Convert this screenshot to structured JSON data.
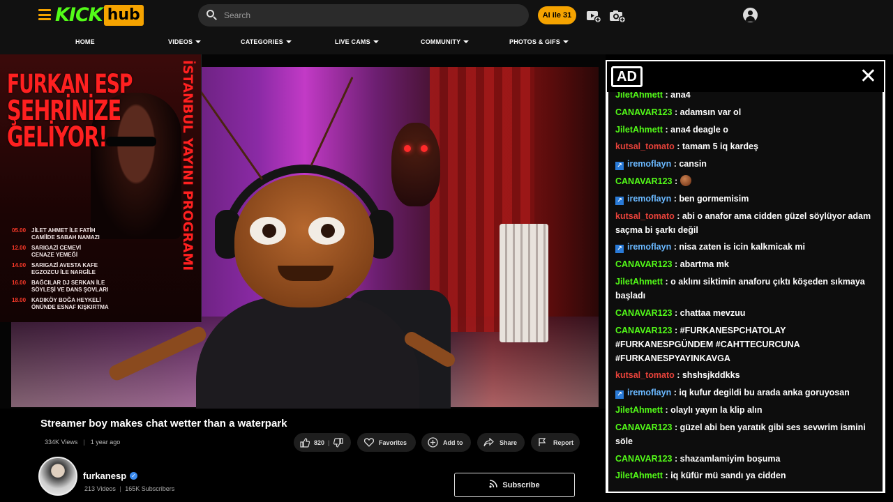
{
  "header": {
    "logo_kick": "KICK",
    "logo_hub": "hub",
    "search_placeholder": "Search",
    "ai_button": "AI ile 31"
  },
  "nav": [
    {
      "label": "HOME"
    },
    {
      "label": "VIDEOS"
    },
    {
      "label": "CATEGORIES"
    },
    {
      "label": "LIVE CAMS"
    },
    {
      "label": "COMMUNITY"
    },
    {
      "label": "PHOTOS & GIFS"
    }
  ],
  "poster": {
    "title_line1": "FURKAN ESP",
    "title_line2": "ŞEHRİNİZE",
    "title_line3": "GELİYOR!",
    "vertical_text": "İSTANBUL YAYINI PROGRAMI",
    "schedule": [
      {
        "time": "05.00",
        "text": "JİLET AHMET İLE FATİH\nCAMİİDE SABAH NAMAZI"
      },
      {
        "time": "12.00",
        "text": "SARIGAZİ CEMEVİ\nCENAZE YEMEĞİ"
      },
      {
        "time": "14.00",
        "text": "SARIGAZİ AVESTA KAFE\nEGZOZCU İLE NARGİLE"
      },
      {
        "time": "16.00",
        "text": "BAĞCILAR DJ SERKAN İLE\nSÖYLEŞİ VE DANS ŞOVLARI"
      },
      {
        "time": "18.00",
        "text": "KADIKÖY BOĞA HEYKELİ\nÖNÜNDE ESNAF KIŞKIRTMA"
      }
    ]
  },
  "video": {
    "title": "Streamer boy makes chat wetter than a waterpark",
    "views": "334K Views",
    "age": "1 year ago",
    "sep": "|",
    "likes": "820",
    "favorites_label": "Favorites",
    "add_label": "Add to",
    "share_label": "Share",
    "report_label": "Report"
  },
  "channel": {
    "name": "furkanesp",
    "videos": "213 Videos",
    "subscribers": "165K Subscribers",
    "sep": "|",
    "subscribe_label": "Subscribe"
  },
  "ad": {
    "label": "AD",
    "close": "✕"
  },
  "chat": [
    {
      "user": "JiletAhmett",
      "color": "green",
      "text": " : ana4"
    },
    {
      "user": "CANAVAR123",
      "color": "green",
      "text": " : adamsın var ol"
    },
    {
      "user": "JiletAhmett",
      "color": "green",
      "text": " : ana4 deagle o"
    },
    {
      "user": "kutsal_tomato",
      "color": "red",
      "text": " : tamam 5 iq kardeş"
    },
    {
      "user": "iremoflayn",
      "color": "blue",
      "text": " : cansin"
    },
    {
      "user": "CANAVAR123",
      "color": "green",
      "text": " :"
    },
    {
      "user": "iremoflayn",
      "color": "blue",
      "text": " : ben gormemisim"
    },
    {
      "user": "kutsal_tomato",
      "color": "red",
      "text": " : abi o anafor ama cidden güzel söylüyor adam saçma bi şarkı değil"
    },
    {
      "user": "iremoflayn",
      "color": "blue",
      "text": " : nisa zaten is icin kalkmicak mi"
    },
    {
      "user": "CANAVAR123",
      "color": "green",
      "text": " : abartma mk"
    },
    {
      "user": "JiletAhmett",
      "color": "green",
      "text": " : o aklını siktimin anaforu çıktı köşeden sıkmaya başladı"
    },
    {
      "user": "CANAVAR123",
      "color": "green",
      "text": " : chattaa mevzuu"
    },
    {
      "user": "CANAVAR123",
      "color": "green",
      "text": " : #FURKANESPCHATOLAY #FURKANESPGÜNDEM #CAHTTECURCUNA #FURKANESPYAYINKAVGA"
    },
    {
      "user": "kutsal_tomato",
      "color": "red",
      "text": " : shshsjkddkks"
    },
    {
      "user": "iremoflayn",
      "color": "blue",
      "text": " : iq kufur degildi bu arada anka goruyosan"
    },
    {
      "user": "JiletAhmett",
      "color": "green",
      "text": " : olaylı yayın la klip alın"
    },
    {
      "user": "CANAVAR123",
      "color": "green",
      "text": " : güzel abi ben yaratık gibi ses sevwrim ismini söle"
    },
    {
      "user": "CANAVAR123",
      "color": "green",
      "text": " : shazamlamiyim boşuma"
    },
    {
      "user": "JiletAhmett",
      "color": "green",
      "text": " : iq küfür mü sandı ya cidden"
    }
  ]
}
